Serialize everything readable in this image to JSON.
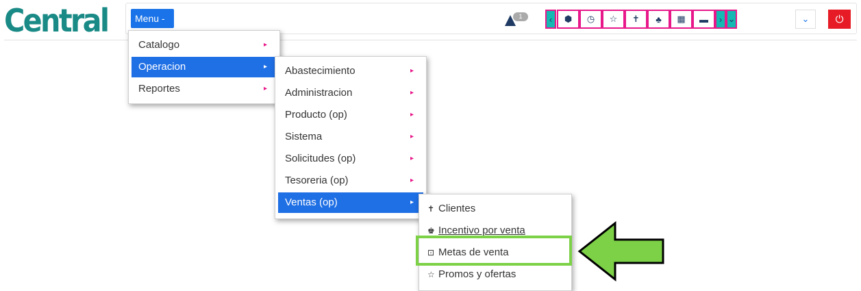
{
  "brand": {
    "logo_text": "Central"
  },
  "header": {
    "menu_button_label": "Menu -",
    "notification_count": "1",
    "toolbar": {
      "prev": "‹",
      "icons": [
        "box-icon",
        "clock-icon",
        "star-icon",
        "person-icon",
        "tree-icon",
        "calendar-icon",
        "card-icon"
      ],
      "next": "›",
      "expand": "⌄",
      "collapse": "⌄",
      "power": "⏻"
    }
  },
  "menu_level1": {
    "items": [
      {
        "label": "Catalogo"
      },
      {
        "label": "Operacion"
      },
      {
        "label": "Reportes"
      }
    ],
    "caret": "▸"
  },
  "menu_level2": {
    "items": [
      {
        "label": "Abastecimiento"
      },
      {
        "label": "Administracion"
      },
      {
        "label": "Producto (op)"
      },
      {
        "label": "Sistema"
      },
      {
        "label": "Solicitudes (op)"
      },
      {
        "label": "Tesoreria (op)"
      },
      {
        "label": "Ventas (op)"
      }
    ],
    "caret": "▸"
  },
  "menu_level3": {
    "items": [
      {
        "label": "Clientes",
        "icon": "person-icon",
        "glyph": "✝"
      },
      {
        "label": "Incentivo por venta",
        "icon": "gift-icon",
        "glyph": "♚"
      },
      {
        "label": "Metas de venta",
        "icon": "goals-icon",
        "glyph": "⊡"
      },
      {
        "label": "Promos y ofertas",
        "icon": "star-outline-icon",
        "glyph": "☆"
      }
    ]
  },
  "colors": {
    "accent_blue": "#1f6fe5",
    "highlight_green": "#7cd147",
    "toolbar_pink": "#e8178a",
    "toolbar_teal": "#16b8b3",
    "power_red": "#e61b25",
    "logo_teal": "#1a8a86"
  }
}
